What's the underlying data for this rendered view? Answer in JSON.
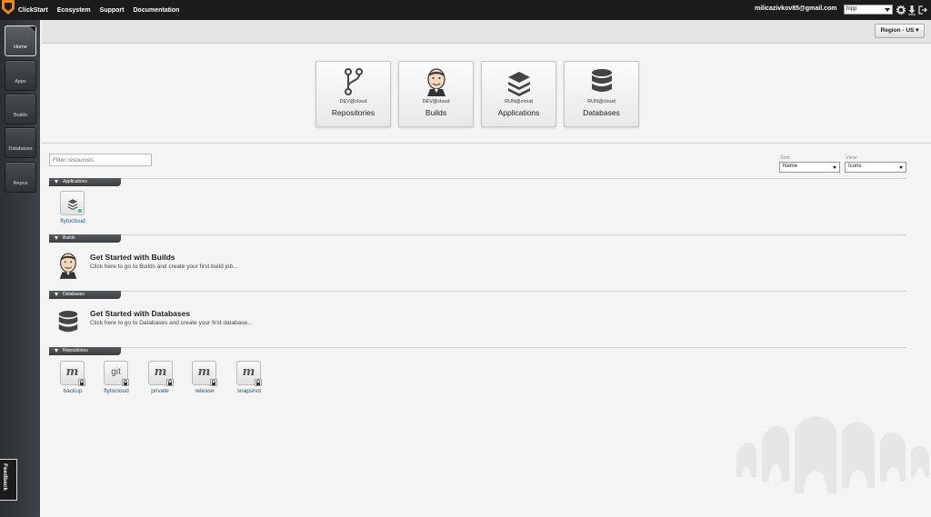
{
  "topbar": {
    "nav": [
      "ClickStart",
      "Ecosystem",
      "Support",
      "Documentation"
    ],
    "user_email": "milicazivkov85@gmail.com",
    "app_selected": "hipp"
  },
  "sidebar": {
    "items": [
      {
        "label": "Home"
      },
      {
        "label": "Apps"
      },
      {
        "label": "Builds"
      },
      {
        "label": "Databases"
      },
      {
        "label": "Repos"
      }
    ],
    "feedback_label": "Feedback"
  },
  "header": {
    "region_label": "Region - US"
  },
  "services": [
    {
      "sub": "DEV@cloud",
      "title": "Repositories",
      "icon": "git-branch-icon"
    },
    {
      "sub": "DEV@cloud",
      "title": "Builds",
      "icon": "jenkins-icon"
    },
    {
      "sub": "RUN@cloud",
      "title": "Applications",
      "icon": "layers-icon"
    },
    {
      "sub": "RUN@cloud",
      "title": "Databases",
      "icon": "database-icon"
    }
  ],
  "filter": {
    "placeholder": "Filter resources",
    "sort_label": "Sort:",
    "sort_value": "Name",
    "view_label": "View:",
    "view_value": "Icons"
  },
  "sections": {
    "applications": {
      "label": "Applications",
      "items": [
        {
          "name": "flytocloud",
          "status_color": "#35c37c"
        }
      ]
    },
    "builds": {
      "label": "Builds",
      "title": "Get Started with Builds",
      "text": "Click here to go to Builds and create your first build job..."
    },
    "databases": {
      "label": "Databases",
      "title": "Get Started with Databases",
      "text": "Click here to go to Databases and create your first database..."
    },
    "repositories": {
      "label": "Repositories",
      "items": [
        {
          "name": "backup",
          "glyph": "m"
        },
        {
          "name": "flytocloud",
          "glyph": "git"
        },
        {
          "name": "private",
          "glyph": "m"
        },
        {
          "name": "release",
          "glyph": "m"
        },
        {
          "name": "snapshot",
          "glyph": "m"
        }
      ]
    }
  }
}
